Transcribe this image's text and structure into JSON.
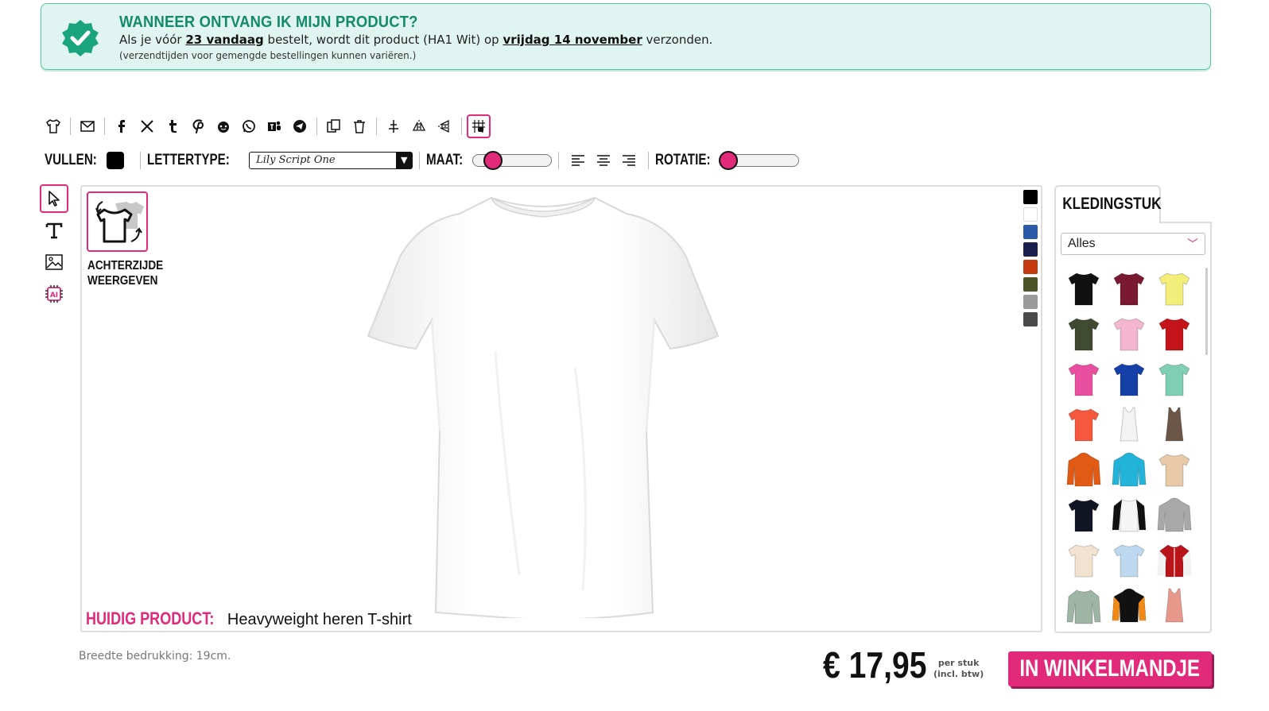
{
  "banner": {
    "title": "WANNEER ONTVANG IK MIJN PRODUCT?",
    "line_prefix": "Als je vóór",
    "deadline": "23 vandaag",
    "line_middle": "bestelt, wordt dit product (HA1 Wit) op",
    "ship_date": "vrijdag 14 november",
    "line_suffix": "verzonden.",
    "note": "(verzendtijden voor gemengde bestellingen kunnen variëren.)",
    "accent_color": "#158a6a"
  },
  "toolbar": {
    "icons": [
      "shirt-icon",
      "email-icon",
      "facebook-icon",
      "x-icon",
      "tumblr-icon",
      "pinterest-icon",
      "reddit-icon",
      "whatsapp-icon",
      "teams-icon",
      "telegram-icon",
      "copy-icon",
      "trash-icon",
      "center-icon",
      "flip-horizontal-icon",
      "flip-vertical-icon",
      "grid-icon"
    ]
  },
  "options": {
    "fill_label": "VULLEN:",
    "fill_color": "#000000",
    "font_label": "LETTERTYPE:",
    "font_value": "Lily Script One",
    "size_label": "MAAT:",
    "size_level": 0.1,
    "rotation_label": "ROTATIE:",
    "rotation_level": 0.0
  },
  "canvas": {
    "flip_label": "ACHTERZIJDE WEERGEVEN",
    "current_label": "HUIDIG PRODUCT:",
    "current_product": "Heavyweight heren T-shirt",
    "shirt_color": "#ffffff",
    "swatch_colors": [
      "#000000",
      "#ffffff",
      "#2a5aa8",
      "#1a1f4e",
      "#c43b12",
      "#4a5226",
      "#9b9b9b",
      "#4a4a4a"
    ]
  },
  "garment": {
    "tab_label": "KLEDINGSTUK",
    "category": "Alles",
    "items": [
      {
        "kind": "tee",
        "color": "#111111"
      },
      {
        "kind": "tee",
        "color": "#7a1a32"
      },
      {
        "kind": "tee",
        "color": "#f3ee7a"
      },
      {
        "kind": "tee",
        "color": "#3f4a30"
      },
      {
        "kind": "tee",
        "color": "#f4b6cf"
      },
      {
        "kind": "tee",
        "color": "#c3141a"
      },
      {
        "kind": "tee",
        "color": "#e94f9f"
      },
      {
        "kind": "tee",
        "color": "#1440a8"
      },
      {
        "kind": "tee",
        "color": "#7ecfb3"
      },
      {
        "kind": "tee",
        "color": "#f4573b"
      },
      {
        "kind": "tank",
        "color": "#f3f3f3"
      },
      {
        "kind": "tank",
        "color": "#6b5648"
      },
      {
        "kind": "hoodie",
        "color": "#e05a14"
      },
      {
        "kind": "hoodie",
        "color": "#22b4d8"
      },
      {
        "kind": "tee",
        "color": "#e8c9a8"
      },
      {
        "kind": "tee",
        "color": "#121624"
      },
      {
        "kind": "raglan",
        "color": "#f5f5f5"
      },
      {
        "kind": "hoodie",
        "color": "#a8a8a8"
      },
      {
        "kind": "tee",
        "color": "#f1e3d0"
      },
      {
        "kind": "tee",
        "color": "#bcd9ef"
      },
      {
        "kind": "jacket",
        "color": "#b8141a"
      },
      {
        "kind": "longsleeve",
        "color": "#9eb5a5"
      },
      {
        "kind": "hoodie",
        "color": "#111111"
      },
      {
        "kind": "tank",
        "color": "#e8988a"
      }
    ]
  },
  "footer": {
    "print_width": "Breedte bedrukking: 19cm.",
    "price": "€ 17,95",
    "per_unit": "per stuk",
    "incl_vat": "(incl. btw)",
    "cart_label": "IN WINKELMANDJE",
    "accent_color": "#e22a7a"
  }
}
